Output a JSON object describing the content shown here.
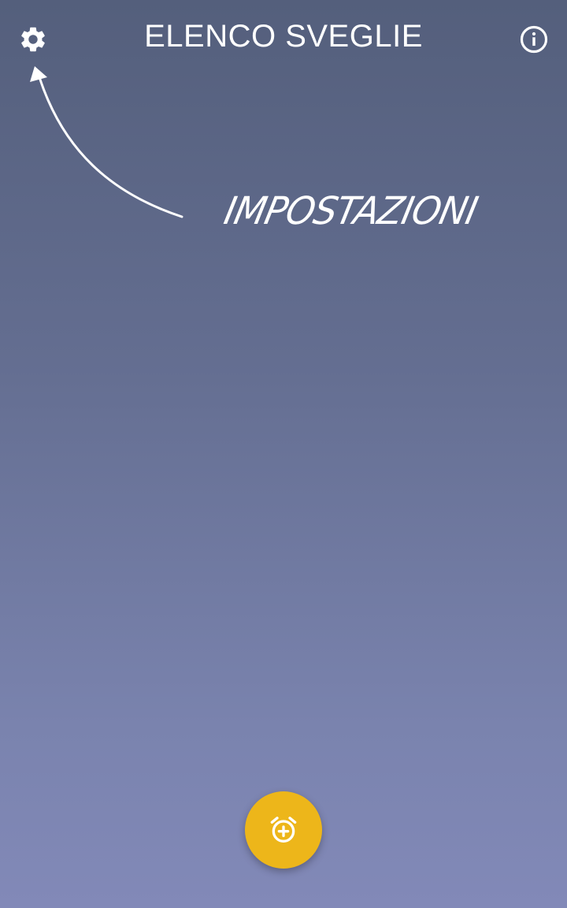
{
  "header": {
    "title": "ELENCO SVEGLIE",
    "settings_icon": "gear-icon",
    "info_icon": "info-icon"
  },
  "hint": {
    "label": "IMPOSTAZIONI",
    "arrow_icon": "curved-arrow-icon"
  },
  "fab": {
    "icon": "add-alarm-icon"
  },
  "colors": {
    "background_top": "#545f7c",
    "background_bottom": "#8289b8",
    "accent": "#edb61a",
    "foreground": "#ffffff"
  }
}
